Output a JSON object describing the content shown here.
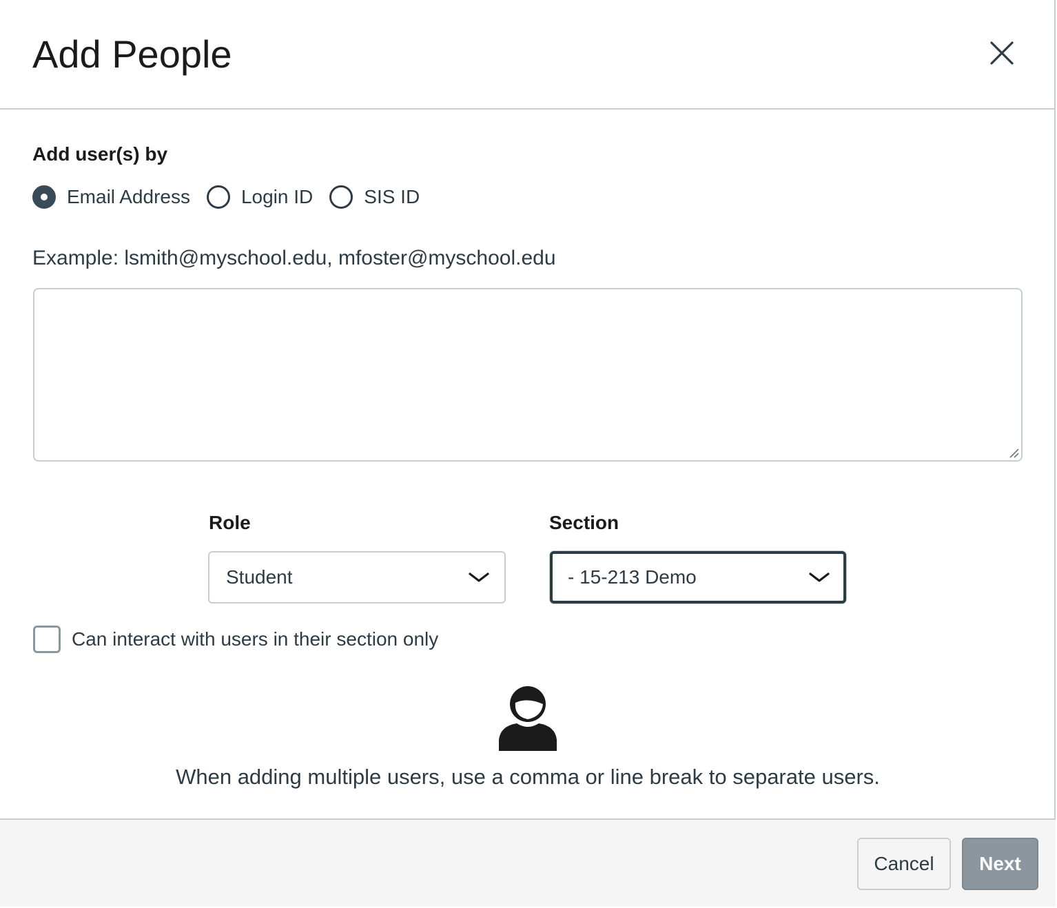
{
  "dialog": {
    "title": "Add People",
    "close_icon": "close-icon"
  },
  "add_by": {
    "label": "Add user(s) by",
    "options": [
      {
        "label": "Email Address",
        "checked": true
      },
      {
        "label": "Login ID",
        "checked": false
      },
      {
        "label": "SIS ID",
        "checked": false
      }
    ]
  },
  "users_input": {
    "example": "Example: lsmith@myschool.edu, mfoster@myschool.edu",
    "value": ""
  },
  "role": {
    "label": "Role",
    "selected": "Student",
    "icon": "chevron-down-icon"
  },
  "section": {
    "label": "Section",
    "selected": "- 15-213 Demo",
    "icon": "chevron-down-icon"
  },
  "limit_section": {
    "label": "Can interact with users in their section only",
    "checked": false
  },
  "hint": {
    "icon": "person-icon",
    "text": "When adding multiple users, use a comma or line break to separate users."
  },
  "footer": {
    "cancel_label": "Cancel",
    "next_label": "Next"
  },
  "colors": {
    "text": "#2d3b45",
    "border": "#c7cdd1",
    "disabled_button": "#8b969e",
    "footer_bg": "#f5f5f5"
  }
}
